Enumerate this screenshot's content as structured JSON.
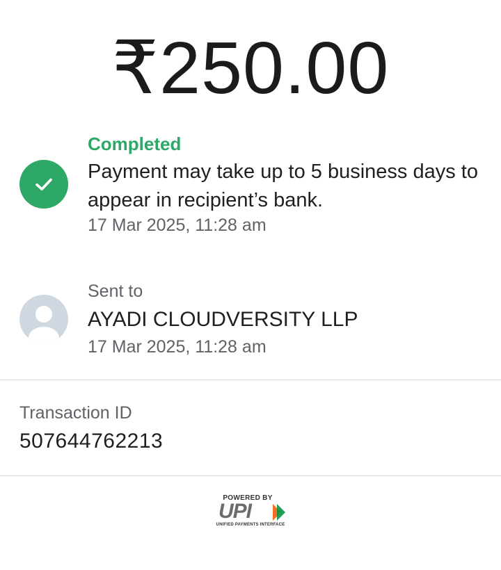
{
  "payment": {
    "amount": "₹250.00"
  },
  "status": {
    "label": "Completed",
    "message": "Payment may take up to 5 business days to appear in recipient’s bank.",
    "timestamp": "17 Mar 2025, 11:28 am",
    "icon": "check-circle-icon",
    "color": "#2ea867"
  },
  "recipient": {
    "label": "Sent to",
    "name": "AYADI CLOUDVERSITY LLP",
    "timestamp": "17 Mar 2025, 11:28 am",
    "icon": "avatar-icon"
  },
  "transaction": {
    "label": "Transaction ID",
    "id": "507644762213"
  },
  "footer": {
    "powered_by": "POWERED BY",
    "brand": "UPI",
    "tagline": "UNIFIED PAYMENTS INTERFACE"
  }
}
